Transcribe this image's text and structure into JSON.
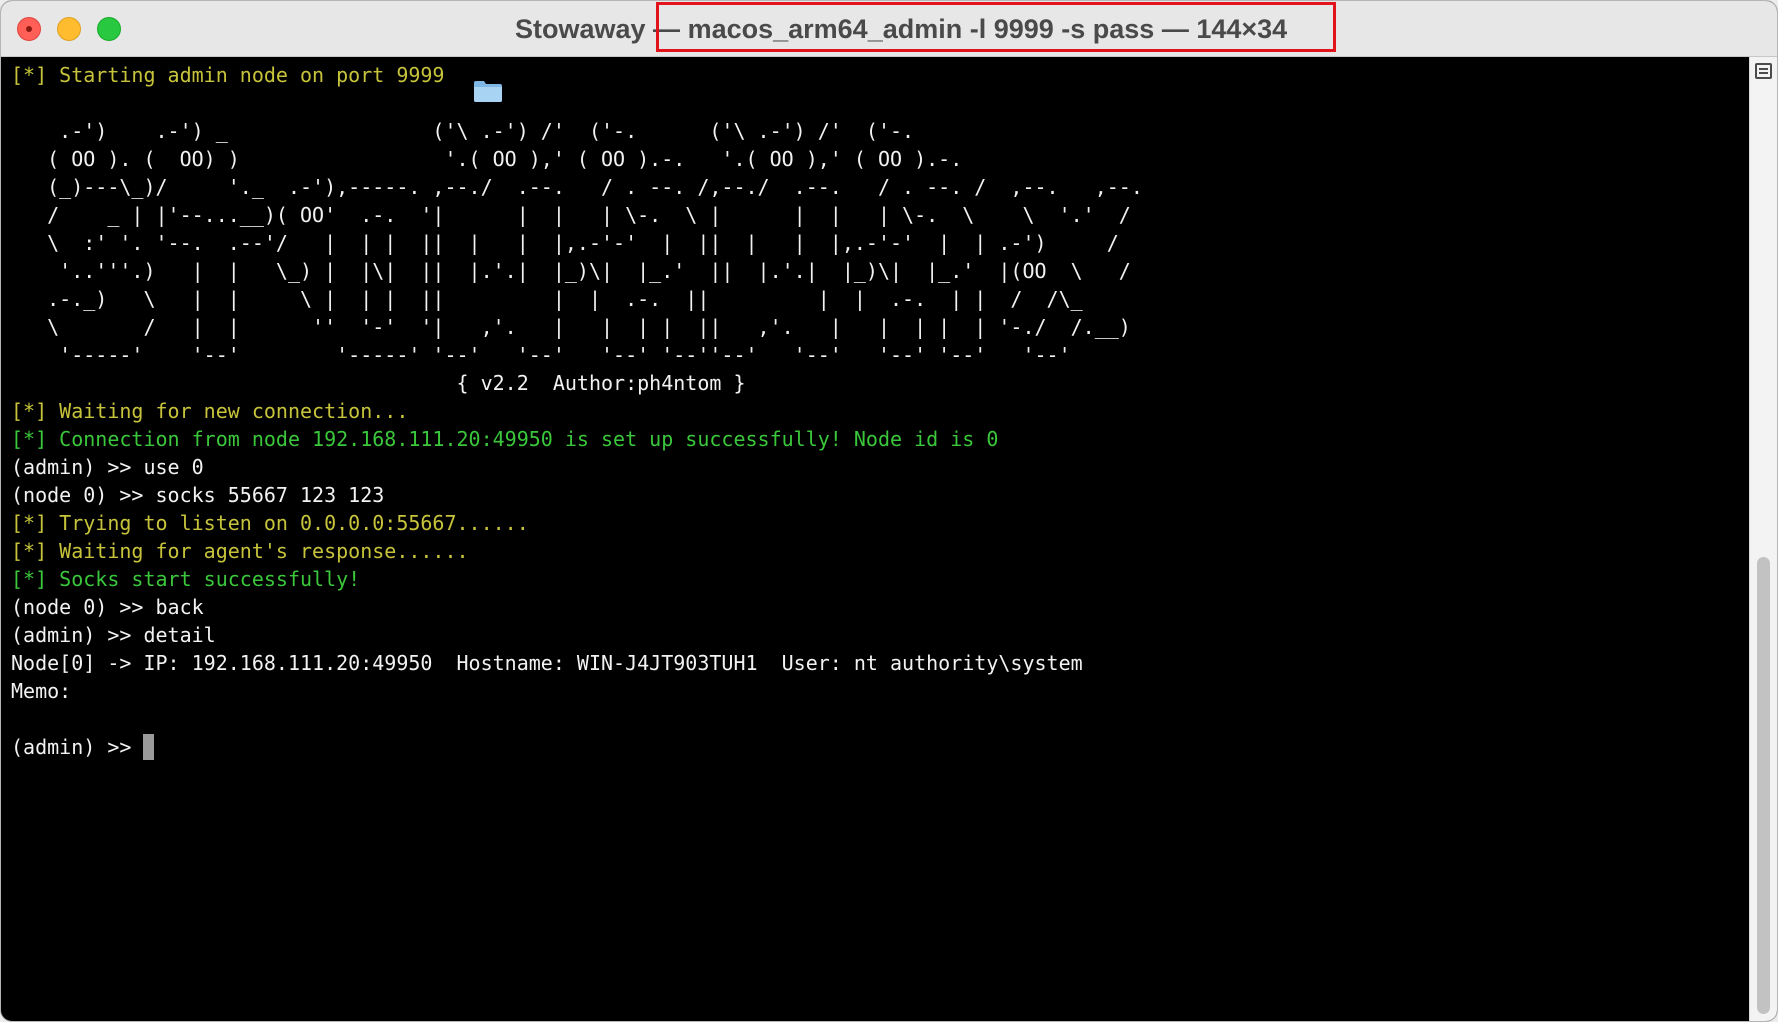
{
  "window": {
    "title_app": "Stowaway",
    "title_sep": " — ",
    "title_command": "macos_arm64_admin -l 9999 -s pass — 144×34"
  },
  "terminal": {
    "lines": [
      {
        "text": "[*] Starting admin node on port 9999",
        "color": "yellow"
      },
      {
        "text": "",
        "color": "white"
      },
      {
        "text": "    .-')    .-') _                 ('\\ .-') /'  ('-.      ('\\ .-') /'  ('-.",
        "color": "white"
      },
      {
        "text": "   ( OO ). (  OO) )                 '.( OO ),' ( OO ).-.   '.( OO ),' ( OO ).-.",
        "color": "white"
      },
      {
        "text": "   (_)---\\_)/     '._  .-'),-----. ,--./  .--.   / . --. /,--./  .--.   / . --. /  ,--.   ,--.",
        "color": "white"
      },
      {
        "text": "   /    _ | |'--...__)( OO'  .-.  '|      |  |   | \\-.  \\ |      |  |   | \\-.  \\    \\  '.'  /",
        "color": "white"
      },
      {
        "text": "   \\  :' '. '--.  .--'/   |  | |  ||  |   |  |,.-'-'  |  ||  |   |  |,.-'-'  |  | .-')     /",
        "color": "white"
      },
      {
        "text": "    '..'''.)   |  |   \\_) |  |\\|  ||  |.'.|  |_)\\|  |_.'  ||  |.'.|  |_)\\|  |_.'  |(OO  \\   /",
        "color": "white"
      },
      {
        "text": "   .-._)   \\   |  |     \\ |  | |  ||         |  |  .-.  ||         |  |  .-.  | |  /  /\\_",
        "color": "white"
      },
      {
        "text": "   \\       /   |  |      ''  '-'  '|   ,'.   |   |  | |  ||   ,'.   |   |  | |  | '-./  /.__)",
        "color": "white"
      },
      {
        "text": "    '-----'    '--'        '-----' '--'   '--'   '--' '--''--'   '--'   '--' '--'   '--'",
        "color": "white"
      },
      {
        "text": "                                     { v2.2  Author:ph4ntom }",
        "color": "white"
      },
      {
        "text": "[*] Waiting for new connection...",
        "color": "yellow"
      },
      {
        "text": "[*] Connection from node 192.168.111.20:49950 is set up successfully! Node id is 0",
        "color": "green"
      },
      {
        "text": "(admin) >> use 0",
        "color": "white"
      },
      {
        "text": "(node 0) >> socks 55667 123 123",
        "color": "white"
      },
      {
        "text": "[*] Trying to listen on 0.0.0.0:55667......",
        "color": "yellow"
      },
      {
        "text": "[*] Waiting for agent's response......",
        "color": "yellow"
      },
      {
        "text": "[*] Socks start successfully!",
        "color": "green"
      },
      {
        "text": "(node 0) >> back",
        "color": "white"
      },
      {
        "text": "(admin) >> detail",
        "color": "white"
      },
      {
        "text": "Node[0] -> IP: 192.168.111.20:49950  Hostname: WIN-J4JT903TUH1  User: nt authority\\system",
        "color": "white"
      },
      {
        "text": "Memo:",
        "color": "white"
      },
      {
        "text": "",
        "color": "white"
      }
    ],
    "prompt": "(admin) >> "
  },
  "colors": {
    "yellow": "#c7c43b",
    "green": "#3bc73b",
    "white": "#f2f2f2",
    "background": "#000000",
    "highlight_border": "#e3131b"
  },
  "icons": {
    "title_icon": "folder-icon"
  }
}
